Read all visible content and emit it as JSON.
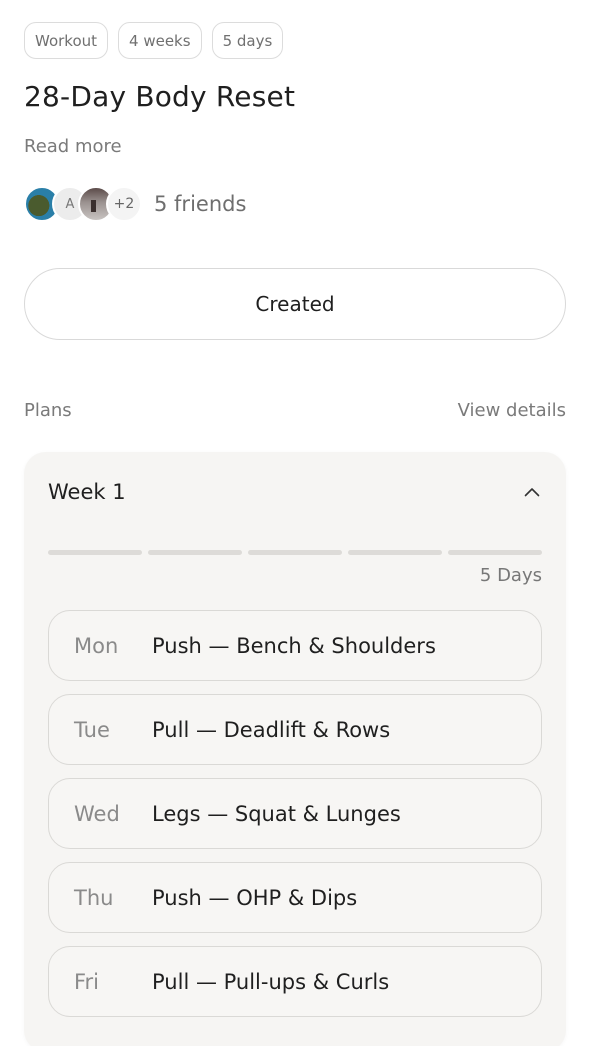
{
  "tags": [
    "Workout",
    "4 weeks",
    "5 days"
  ],
  "program": {
    "title": "28-Day Body Reset",
    "read_more": "Read more"
  },
  "friends": {
    "avatar_initial": "A",
    "more_count": "+2",
    "label": "5 friends"
  },
  "status_button": "Created",
  "plans_section": {
    "label": "Plans",
    "link": "View details"
  },
  "week": {
    "title": "Week 1",
    "chevron_icon": "chevron-up-icon",
    "days_count": "5 Days",
    "days": [
      {
        "day": "Mon",
        "plan": "Push — Bench & Shoulders"
      },
      {
        "day": "Tue",
        "plan": "Pull — Deadlift & Rows"
      },
      {
        "day": "Wed",
        "plan": "Legs — Squat & Lunges"
      },
      {
        "day": "Thu",
        "plan": "Push — OHP & Dips"
      },
      {
        "day": "Fri",
        "plan": "Pull — Pull-ups & Curls"
      }
    ]
  },
  "colors": {
    "background": "#ffffff",
    "card": "#f6f5f3",
    "border": "#dcdcdc",
    "text_primary": "#1f1f1f",
    "text_muted": "#7a7a7a"
  }
}
